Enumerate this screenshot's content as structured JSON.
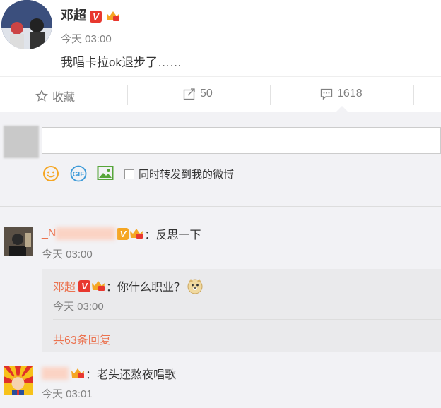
{
  "post": {
    "author": "邓超",
    "time": "今天 03:00",
    "text": "我唱卡拉ok退步了……"
  },
  "actions": {
    "favorite_label": "收藏",
    "repost_count": "50",
    "comment_count": "1618"
  },
  "composer": {
    "share_label": "同时转发到我的微博"
  },
  "comments": [
    {
      "author": "_N",
      "text": "：反思一下",
      "time": "今天 03:00",
      "reply": {
        "author": "邓超",
        "text": "：你什么职业？",
        "time": "今天 03:00",
        "more": "共63条回复"
      }
    },
    {
      "author": "",
      "text": "：老头还熬夜唱歌",
      "time": "今天 03:01"
    }
  ],
  "colors": {
    "accent": "#eb7350",
    "vip_red": "#e8382f",
    "background": "#f2f2f5"
  }
}
